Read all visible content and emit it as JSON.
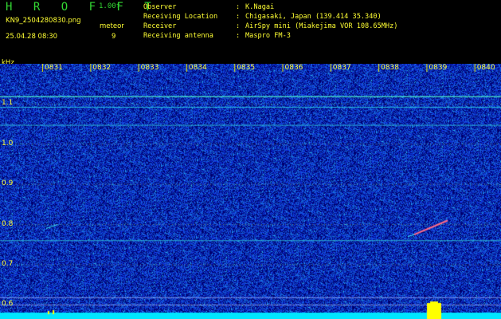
{
  "header": {
    "title": "H R O F F T",
    "version": "1.00f",
    "filename": "KN9_2504280830.png",
    "timestamp": "25.04.28 08:30",
    "meteor_label": "meteor",
    "meteor_count": "9"
  },
  "info": [
    {
      "key": "Observer",
      "sep": ":",
      "value": "K.Nagai"
    },
    {
      "key": "Receiving Location",
      "sep": ":",
      "value": "Chigasaki, Japan (139.414 35.340)"
    },
    {
      "key": "Receiver",
      "sep": ":",
      "value": "AirSpy mini (Miakejima VOR 108.65MHz)"
    },
    {
      "key": "Receiving antenna",
      "sep": ":",
      "value": "Maspro FM-3"
    }
  ],
  "spectrogram": {
    "unit_label": "kHz",
    "y_ticks": [
      "1.1",
      "1.0",
      "0.9",
      "0.8",
      "0.7",
      "0.6"
    ],
    "y_tick_values": [
      1.1,
      1.0,
      0.9,
      0.8,
      0.7,
      0.6
    ],
    "y_range": [
      0.565,
      1.2
    ],
    "time_ticks": [
      "0831",
      "0832",
      "0833",
      "0834",
      "0835",
      "0836",
      "0837",
      "0838",
      "0839",
      "0840"
    ],
    "time_range": [
      "0830",
      "0840"
    ],
    "colors": {
      "background": "#00006e",
      "noise": "#1e46c8",
      "carrier": "#33e6e6",
      "floor": "#00e6ff",
      "meteor": "#ffff00"
    }
  }
}
